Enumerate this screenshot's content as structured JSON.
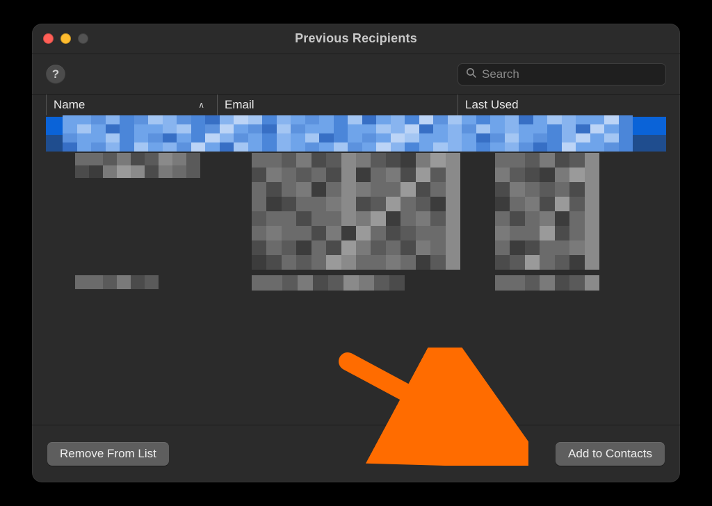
{
  "window": {
    "title": "Previous Recipients",
    "help_symbol": "?"
  },
  "search": {
    "placeholder": "Search",
    "value": ""
  },
  "columns": {
    "name": "Name",
    "email": "Email",
    "last_used": "Last Used",
    "sort_indicator": "∧"
  },
  "footer": {
    "remove_label": "Remove From List",
    "add_label": "Add to Contacts"
  },
  "annotation": {
    "arrow_color": "#ff6c00"
  }
}
